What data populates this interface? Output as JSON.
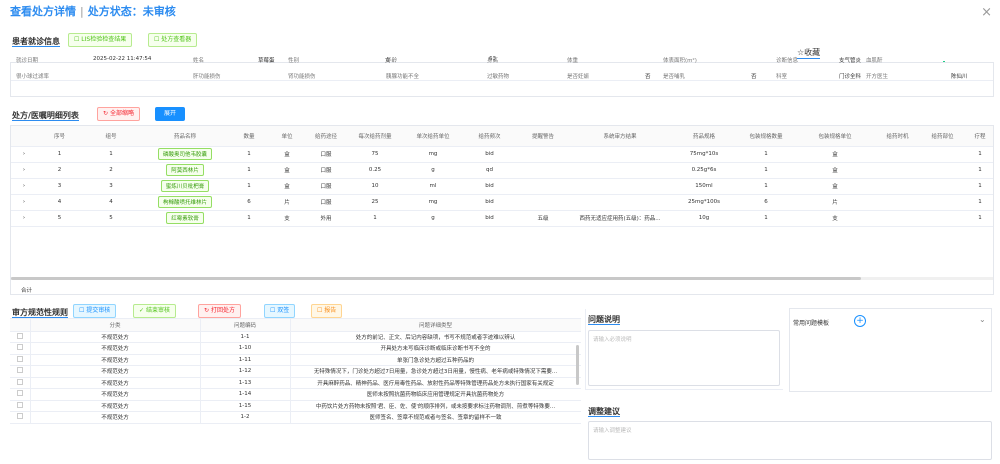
{
  "header": {
    "title": "查看处方详情",
    "sep": "|",
    "status": "处方状态：未审核"
  },
  "patient": {
    "title": "患者就诊信息",
    "btn_lis": "LIS检验检查结果",
    "btn_view": "处方查看器",
    "favorite": "☆收藏",
    "r1": [
      [
        "就诊日期",
        "2025-02-22 11:47:54"
      ],
      [
        "姓名",
        "草莓蛋"
      ],
      [
        "性别",
        "女"
      ],
      [
        "年龄",
        "63"
      ],
      [
        "身高",
        ""
      ],
      [
        "体重",
        ""
      ],
      [
        "体表面积(m²)",
        ""
      ],
      [
        "诊断信息",
        "支气管炎"
      ],
      [
        "血肌酐",
        ""
      ]
    ],
    "r2": [
      [
        "很小球过滤率",
        ""
      ],
      [
        "肝功能损伤",
        ""
      ],
      [
        "肾功能损伤",
        ""
      ],
      [
        "胰腺功能不全",
        ""
      ],
      [
        "过敏药物",
        ""
      ],
      [
        "是否妊娠",
        "否"
      ],
      [
        "是否哺乳",
        "否"
      ],
      [
        "科室",
        "门诊全科"
      ],
      [
        "开方医生",
        "陈仙川"
      ]
    ]
  },
  "orders": {
    "title": "处方/医嘱明细列表",
    "btn_collapse": "全部缩略",
    "btn_expand": "展开",
    "cols": [
      "",
      "序号",
      "组号",
      "药品名称",
      "数量",
      "单位",
      "给药途径",
      "每次给药剂量",
      "单次给药单位",
      "给药频次",
      "提醒警告",
      "系统审方结果",
      "药品规格",
      "包装规格数量",
      "包装规格单位",
      "给药时机",
      "给药部位",
      "疗程"
    ],
    "rows": [
      [
        "›",
        "1",
        "1",
        "磷酸奥司他韦胶囊",
        "1",
        "盒",
        "口服",
        "75",
        "mg",
        "bid",
        "",
        "",
        "75mg*10s",
        "1",
        "盒",
        "",
        "",
        "1"
      ],
      [
        "›",
        "2",
        "2",
        "阿莫西林片",
        "1",
        "盒",
        "口服",
        "0.25",
        "g",
        "qd",
        "",
        "",
        "0.25g*6s",
        "1",
        "盒",
        "",
        "",
        "1"
      ],
      [
        "›",
        "3",
        "3",
        "蜜炼川贝枇杷膏",
        "1",
        "盒",
        "口服",
        "10",
        "ml",
        "bid",
        "",
        "",
        "150ml",
        "1",
        "盒",
        "",
        "",
        "1"
      ],
      [
        "›",
        "4",
        "4",
        "枸橼酸喷托维林片",
        "6",
        "片",
        "口服",
        "25",
        "mg",
        "bid",
        "",
        "",
        "25mg*100s",
        "6",
        "片",
        "",
        "",
        "1"
      ],
      [
        "›",
        "5",
        "5",
        "红霉素软膏",
        "1",
        "支",
        "外用",
        "1",
        "g",
        "bid",
        "五级",
        "西药无适应症用药(五级)：药品...",
        "10g",
        "1",
        "支",
        "",
        "",
        "1"
      ]
    ],
    "total": "合计"
  },
  "rules": {
    "title": "审方规范性规则",
    "btn_submit": "提交审核",
    "btn_finish": "结束审核",
    "btn_print": "打回处方",
    "btn_sign": "双签",
    "btn_report": "报告",
    "cols": [
      "",
      "分类",
      "问题编码",
      "问题详细类型"
    ],
    "rows": [
      [
        "",
        "不规范处方",
        "1-1",
        "处方的前记、正文、后记内容缺项，书写不规范或者字迹难以辨认"
      ],
      [
        "",
        "不规范处方",
        "1-10",
        "开具处方未写临床诊断或临床诊断书写不全的"
      ],
      [
        "",
        "不规范处方",
        "1-11",
        "单张门急诊处方超过五种药品的"
      ],
      [
        "",
        "不规范处方",
        "1-12",
        "无特殊情况下，门诊处方超过7日用量，急诊处方超过3日用量，慢性病、老年病或特殊情况下需要..."
      ],
      [
        "",
        "不规范处方",
        "1-13",
        "开具麻醉药品、精神药品、医疗用毒性药品、放射性药品等特殊管理药品处方未执行国家有关规定"
      ],
      [
        "",
        "不规范处方",
        "1-14",
        "医师未按照抗菌药物临床应用管理规定开具抗菌药物处方"
      ],
      [
        "",
        "不规范处方",
        "1-15",
        "中药饮片处方药物未按照'君、臣、佐、使'的顺序排列，或未按要求标注药物调剂、煎煮等特殊要..."
      ],
      [
        "",
        "不规范处方",
        "1-2",
        "医师签名、签章不规范或者与签名、签章的留样不一致"
      ]
    ]
  },
  "problem": {
    "title": "问题说明",
    "placeholder": "请输入必须说明",
    "template": "常用问题模板",
    "add": "+",
    "chevron": "⌄"
  },
  "advice": {
    "title": "调整建议",
    "placeholder": "请输入调整建议"
  },
  "close": "×"
}
